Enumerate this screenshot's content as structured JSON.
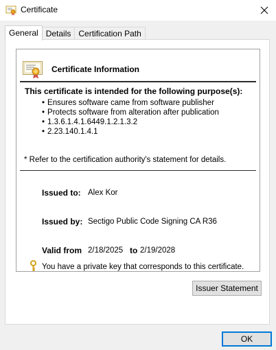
{
  "window": {
    "title": "Certificate",
    "close_icon": "close-icon",
    "title_icon": "certificate-icon"
  },
  "tabs": [
    {
      "label": "General",
      "active": true
    },
    {
      "label": "Details",
      "active": false
    },
    {
      "label": "Certification Path",
      "active": false
    }
  ],
  "info": {
    "icon": "certificate-icon",
    "title": "Certificate Information",
    "purpose_heading": "This certificate is intended for the following purpose(s):",
    "purposes": [
      "Ensures software came from software publisher",
      "Protects software from alteration after publication",
      "1.3.6.1.4.1.6449.1.2.1.3.2",
      "2.23.140.1.4.1"
    ],
    "note": "* Refer to the certification authority's statement for details.",
    "issued_to_label": "Issued to:",
    "issued_to": "Alex Kor",
    "issued_by_label": "Issued by:",
    "issued_by": "Sectigo Public Code Signing CA R36",
    "valid_from_label": "Valid from",
    "valid_from": "2/18/2025",
    "valid_to_label": "to",
    "valid_to": "2/19/2028",
    "private_key_icon": "key-icon",
    "private_key_text": "You have a private key that corresponds to this certificate."
  },
  "buttons": {
    "issuer_statement": "Issuer Statement",
    "ok": "OK"
  },
  "colors": {
    "ok_border": "#0078d7",
    "window_bg": "#f0f0f0"
  }
}
